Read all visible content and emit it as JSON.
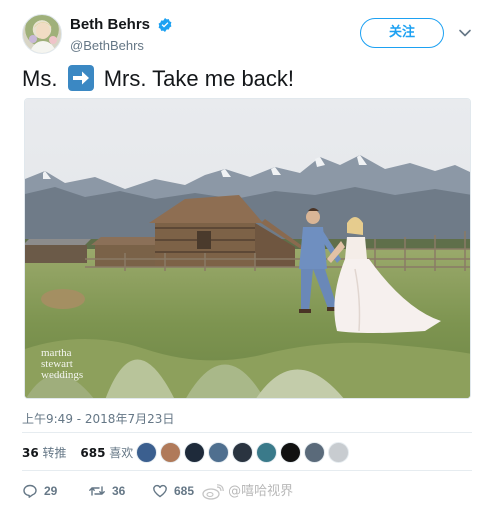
{
  "user": {
    "display_name": "Beth Behrs",
    "handle": "@BethBehrs",
    "verified_icon": "verified-badge-icon"
  },
  "header": {
    "follow_label": "关注",
    "more_icon": "chevron-down-icon"
  },
  "tweet": {
    "text_before": "Ms.",
    "emoji": "right-arrow-emoji-icon",
    "text_after": "Mrs. Take me back!",
    "timestamp": "上午9:49 - 2018年7月23日"
  },
  "photo": {
    "description_icon": "wedding-photo",
    "watermark_lines": [
      "martha",
      "stewart",
      "weddings"
    ]
  },
  "stats": {
    "retweets_count": "36",
    "retweets_label": "转推",
    "likes_count": "685",
    "likes_label": "喜欢",
    "liker_avatar_count": 9
  },
  "actions": {
    "reply_count": "29",
    "retweet_count": "36",
    "like_count": "685"
  },
  "weibo_watermark": "@嘻哈视界",
  "colors": {
    "accent": "#1da1f2",
    "muted": "#657786",
    "text": "#14171a",
    "divider": "#e6ecf0"
  }
}
